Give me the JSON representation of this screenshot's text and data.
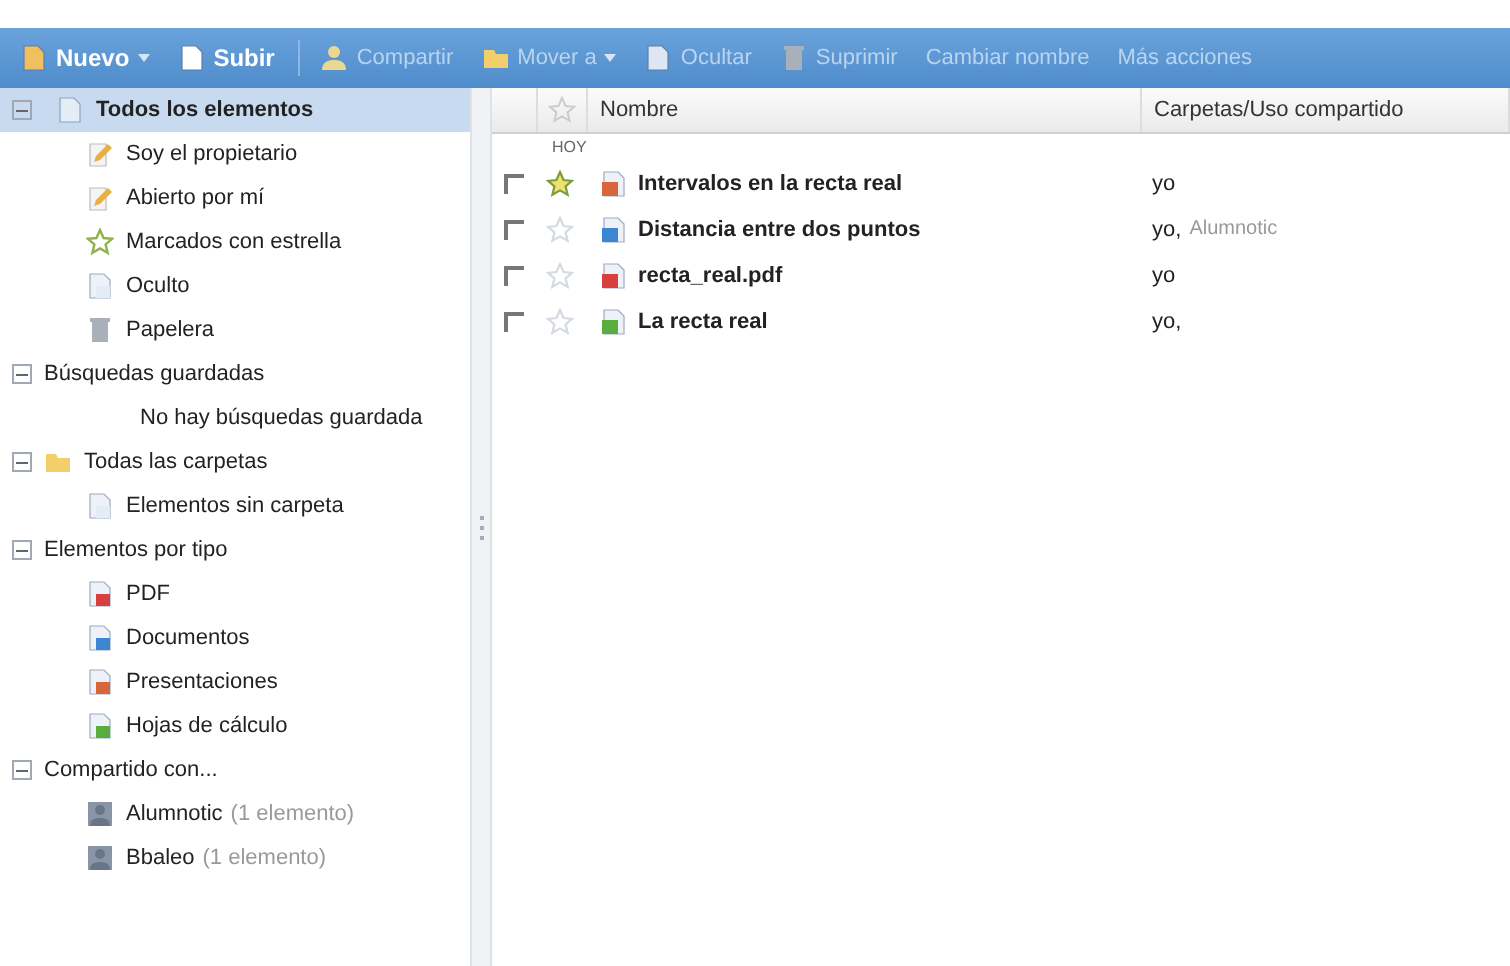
{
  "toolbar": [
    {
      "label": "Nuevo",
      "kind": "new",
      "dropdown": true,
      "disabled": false
    },
    {
      "label": "Subir",
      "kind": "upload",
      "dropdown": false,
      "disabled": false
    },
    {
      "label": "Compartir",
      "kind": "share",
      "dropdown": false,
      "disabled": true
    },
    {
      "label": "Mover a",
      "kind": "folder",
      "dropdown": true,
      "disabled": true
    },
    {
      "label": "Ocultar",
      "kind": "hide",
      "dropdown": false,
      "disabled": true
    },
    {
      "label": "Suprimir",
      "kind": "trash",
      "dropdown": false,
      "disabled": true
    },
    {
      "label": "Cambiar nombre",
      "dropdown": false,
      "disabled": true
    },
    {
      "label": "Más acciones",
      "dropdown": false,
      "disabled": true
    }
  ],
  "sidebar": [
    {
      "label": "Todos los elementos",
      "kind": "doc",
      "expanded": true,
      "selected": true,
      "children": [
        {
          "label": "Soy el propietario",
          "kind": "pencil",
          "selected": false
        },
        {
          "label": "Abierto por mí",
          "kind": "pencil",
          "selected": false
        },
        {
          "label": "Marcados con estrella",
          "kind": "star",
          "selected": false
        },
        {
          "label": "Oculto",
          "kind": "doc",
          "selected": false
        },
        {
          "label": "Papelera",
          "kind": "trash",
          "selected": false
        }
      ]
    },
    {
      "label": "Búsquedas guardadas",
      "expanded": true,
      "selected": false,
      "children": [
        {
          "label": "No hay búsquedas guardada",
          "selected": false
        }
      ]
    },
    {
      "label": "Todas las carpetas",
      "kind": "folder",
      "expanded": true,
      "selected": false,
      "children": [
        {
          "label": "Elementos sin carpeta",
          "kind": "doc",
          "selected": false
        }
      ]
    },
    {
      "label": "Elementos por tipo",
      "expanded": true,
      "selected": false,
      "children": [
        {
          "label": "PDF",
          "kind": "pdf",
          "selected": false
        },
        {
          "label": "Documentos",
          "kind": "document",
          "selected": false
        },
        {
          "label": "Presentaciones",
          "kind": "presentation",
          "selected": false
        },
        {
          "label": "Hojas de cálculo",
          "kind": "spreadsheet",
          "selected": false
        }
      ]
    },
    {
      "label": "Compartido con...",
      "expanded": true,
      "selected": false,
      "children": [
        {
          "label": "Alumnotic",
          "count": "(1 elemento)",
          "kind": "user",
          "selected": false
        },
        {
          "label": "Bbaleo",
          "count": "(1 elemento)",
          "kind": "user",
          "selected": false
        }
      ]
    }
  ],
  "table": {
    "columns": [
      "Nombre",
      "Carpetas/Uso compartido"
    ],
    "group": "HOY",
    "rows": [
      {
        "checked": false,
        "starred": true,
        "kind": "presentation",
        "name": "Intervalos en la recta real",
        "owner": "yo"
      },
      {
        "checked": false,
        "starred": false,
        "kind": "document",
        "name": "Distancia entre dos puntos",
        "owner": "yo,",
        "shared_with": "Alumnotic"
      },
      {
        "checked": false,
        "starred": false,
        "kind": "pdf",
        "name": "recta_real.pdf",
        "owner": "yo"
      },
      {
        "checked": false,
        "starred": false,
        "kind": "spreadsheet",
        "name": "La recta real",
        "owner": "yo,"
      }
    ]
  }
}
